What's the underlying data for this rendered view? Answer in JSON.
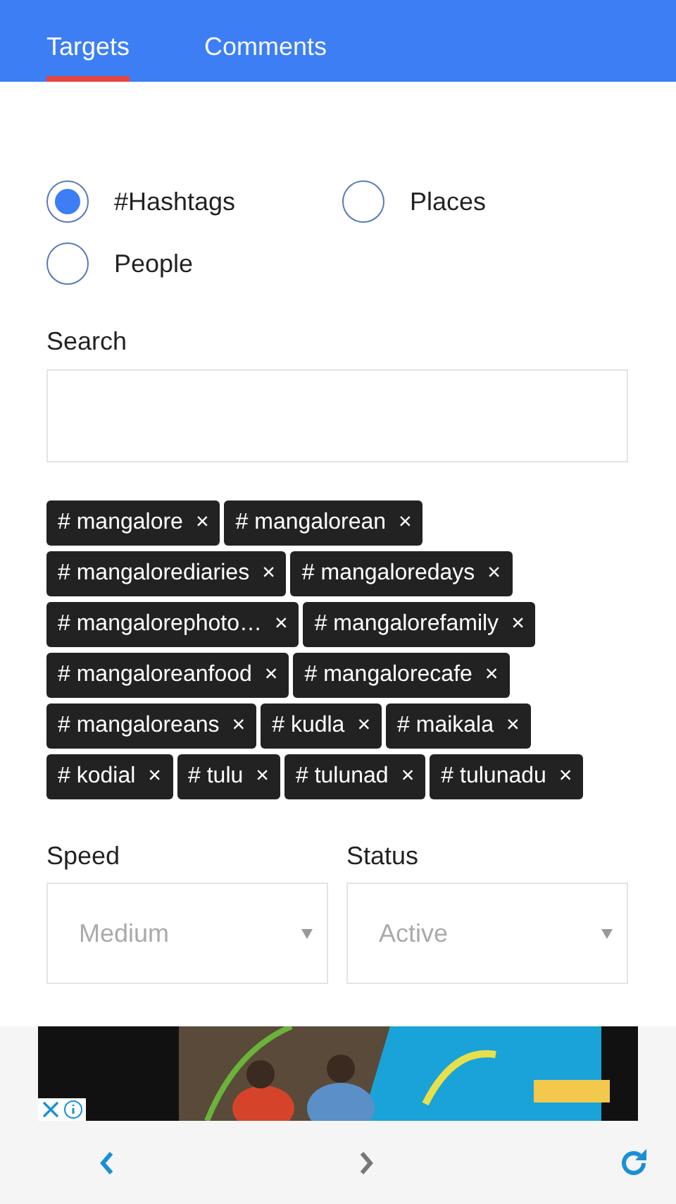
{
  "tabs": [
    {
      "label": "Targets",
      "selected": true
    },
    {
      "label": "Comments",
      "selected": false
    }
  ],
  "target_types": [
    {
      "label": "#Hashtags",
      "selected": true
    },
    {
      "label": "Places",
      "selected": false
    },
    {
      "label": "People",
      "selected": false
    }
  ],
  "search": {
    "label": "Search"
  },
  "tags": [
    {
      "label": "# mangalore",
      "remove": "×"
    },
    {
      "label": "# mangalorean",
      "remove": "×"
    },
    {
      "label": "# mangalorediaries",
      "remove": "×"
    },
    {
      "label": "# mangaloredays",
      "remove": "×"
    },
    {
      "label": "# mangalorephoto…",
      "remove": "×"
    },
    {
      "label": "# mangalorefamily",
      "remove": "×"
    },
    {
      "label": "# mangaloreanfood",
      "remove": "×"
    },
    {
      "label": "# mangalorecafe",
      "remove": "×"
    },
    {
      "label": "# mangaloreans",
      "remove": "×"
    },
    {
      "label": "# kudla",
      "remove": "×"
    },
    {
      "label": "# maikala",
      "remove": "×"
    },
    {
      "label": "# kodial",
      "remove": "×"
    },
    {
      "label": "# tulu",
      "remove": "×"
    },
    {
      "label": "# tulunad",
      "remove": "×"
    },
    {
      "label": "# tulunadu",
      "remove": "×"
    }
  ],
  "selects": [
    {
      "label": "Speed",
      "value": "Medium"
    },
    {
      "label": "Status",
      "value": "Active"
    }
  ],
  "nav": {
    "back": {
      "disabled": false
    },
    "forward": {
      "disabled": true
    }
  }
}
